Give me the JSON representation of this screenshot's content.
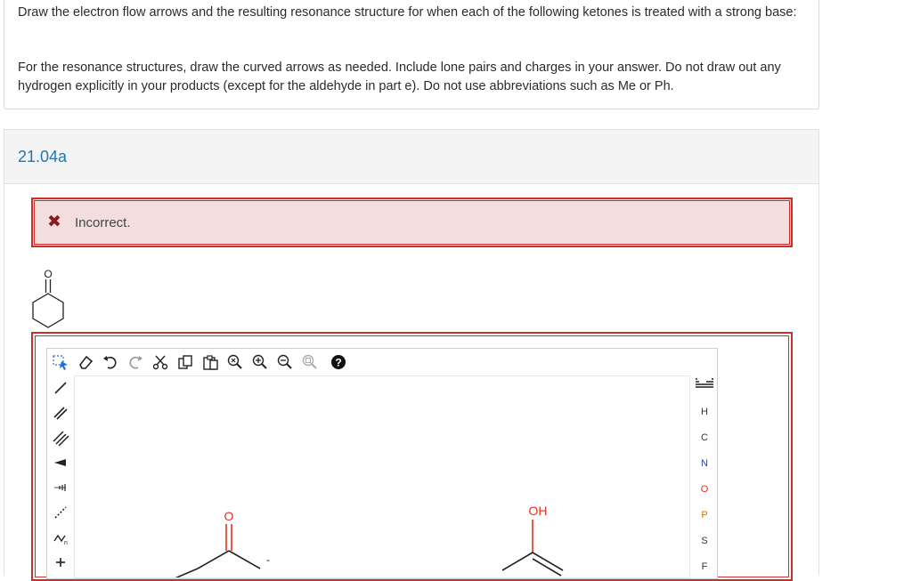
{
  "question": {
    "paragraph1": "Draw the electron flow arrows and the resulting resonance structure for when each of the following ketones is treated with a strong base:",
    "paragraph2": "For the resonance structures, draw the curved arrows as needed. Include lone pairs and charges in your answer. Do not draw out any hydrogen explicitly in your products (except for the aldehyde in part e). Do not use abbreviations such as Me or Ph."
  },
  "part": {
    "title": "21.04a"
  },
  "feedback": {
    "icon": "close-icon",
    "text": "Incorrect."
  },
  "ketone_structure": {
    "atom_label": "O"
  },
  "editor": {
    "top_toolbar": [
      {
        "name": "select-tool",
        "icon": "lasso-select-icon"
      },
      {
        "name": "erase-tool",
        "icon": "eraser-icon"
      },
      {
        "name": "undo-button",
        "icon": "undo-icon"
      },
      {
        "name": "redo-button",
        "icon": "redo-icon"
      },
      {
        "name": "cut-button",
        "icon": "scissors-icon"
      },
      {
        "name": "copy-button",
        "icon": "copy-icon"
      },
      {
        "name": "paste-button",
        "icon": "paste-icon"
      },
      {
        "name": "zoom-reset-button",
        "icon": "zoom-reset-icon"
      },
      {
        "name": "zoom-in-button",
        "icon": "zoom-in-icon"
      },
      {
        "name": "zoom-out-button",
        "icon": "zoom-out-icon"
      },
      {
        "name": "zoom-fit-button",
        "icon": "zoom-fit-icon"
      },
      {
        "name": "help-button",
        "icon": "help-icon"
      }
    ],
    "left_toolbar": [
      {
        "name": "single-bond-tool",
        "icon": "single-bond-icon"
      },
      {
        "name": "double-bond-tool",
        "icon": "double-bond-icon"
      },
      {
        "name": "triple-bond-tool",
        "icon": "triple-bond-icon"
      },
      {
        "name": "wedge-bond-tool",
        "icon": "wedge-bond-icon"
      },
      {
        "name": "hash-bond-tool",
        "icon": "hash-bond-icon"
      },
      {
        "name": "dashed-bond-tool",
        "icon": "dashed-bond-icon"
      },
      {
        "name": "chain-tool",
        "icon": "chain-icon"
      },
      {
        "name": "charge-plus-tool",
        "icon": "plus-charge-icon"
      }
    ],
    "periodic_table_icon": "periodic-table-icon",
    "atoms": [
      {
        "symbol": "H",
        "color": "#333333"
      },
      {
        "symbol": "C",
        "color": "#333333"
      },
      {
        "symbol": "N",
        "color": "#1f3fbf"
      },
      {
        "symbol": "O",
        "color": "#e0301e"
      },
      {
        "symbol": "P",
        "color": "#d9730d"
      },
      {
        "symbol": "S",
        "color": "#333333"
      },
      {
        "symbol": "F",
        "color": "#333333"
      }
    ],
    "canvas": {
      "left_molecule_label": "O",
      "right_molecule_label": "OH",
      "charge_label": "-"
    }
  }
}
